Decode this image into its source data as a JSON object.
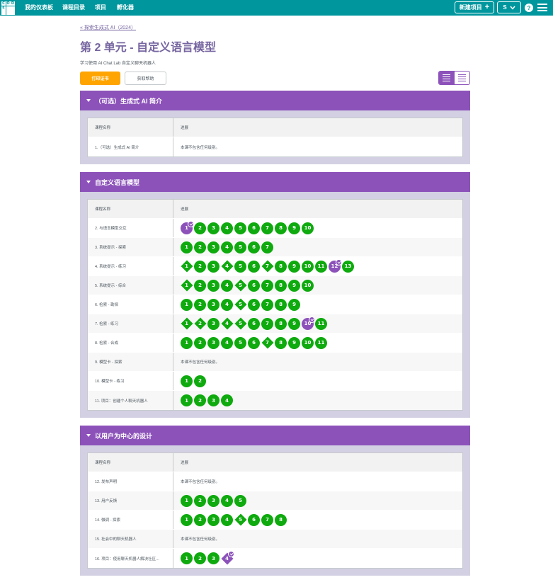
{
  "header": {
    "logo_letters": [
      "C",
      "O",
      "D",
      "E",
      "",
      "",
      "",
      "",
      ""
    ],
    "nav": [
      {
        "label": "我的仪表板"
      },
      {
        "label": "课程目录"
      },
      {
        "label": "项目"
      },
      {
        "label": "孵化器"
      }
    ],
    "new_project_label": "新建项目",
    "new_project_icon": "+",
    "user_initial": "S",
    "help_label": "?"
  },
  "breadcrumb": "« 探索生成式 AI（2024）",
  "title": "第 2 单元 - 自定义语言模型",
  "description": "学习使用 AI Chat Lab 自定义聊天机器人",
  "buttons": {
    "print": "打印证书",
    "help": "获取帮助"
  },
  "colors": {
    "teal": "#00969d",
    "purple": "#8c52ba",
    "green": "#0eaa0e",
    "orange": "#ffa400",
    "title": "#7665a0"
  },
  "table_headers": {
    "name": "课程名称",
    "progress": "进展"
  },
  "no_levels_text": "本课不包含任何级别。",
  "sections": [
    {
      "title": "（可选）生成式 AI 简介",
      "lessons": [
        {
          "name": "1.（可选）生成式 AI 简介",
          "levels": []
        }
      ]
    },
    {
      "title": "自定义语言模型",
      "lessons": [
        {
          "name": "2. 与语言模型交互",
          "levels": [
            {
              "n": "1",
              "shape": "circle",
              "color": "purple",
              "check": true
            },
            {
              "n": "2"
            },
            {
              "n": "3"
            },
            {
              "n": "4"
            },
            {
              "n": "5"
            },
            {
              "n": "6"
            },
            {
              "n": "7"
            },
            {
              "n": "8"
            },
            {
              "n": "9"
            },
            {
              "n": "10"
            }
          ]
        },
        {
          "name": "3. 系统提示 - 探索",
          "levels": [
            {
              "n": "1"
            },
            {
              "n": "2"
            },
            {
              "n": "3"
            },
            {
              "n": "4"
            },
            {
              "n": "5"
            },
            {
              "n": "6"
            },
            {
              "n": "7"
            }
          ]
        },
        {
          "name": "4. 系统提示 - 练习",
          "levels": [
            {
              "n": "1",
              "shape": "diamond"
            },
            {
              "n": "2"
            },
            {
              "n": "3"
            },
            {
              "n": "4",
              "shape": "diamond"
            },
            {
              "n": "5"
            },
            {
              "n": "6"
            },
            {
              "n": "7",
              "shape": "diamond"
            },
            {
              "n": "8"
            },
            {
              "n": "9"
            },
            {
              "n": "10"
            },
            {
              "n": "11"
            },
            {
              "n": "12",
              "color": "purple",
              "check": true
            },
            {
              "n": "13"
            }
          ]
        },
        {
          "name": "5. 系统提示 - 综合",
          "levels": [
            {
              "n": "1",
              "shape": "diamond"
            },
            {
              "n": "2"
            },
            {
              "n": "3"
            },
            {
              "n": "4"
            },
            {
              "n": "5",
              "shape": "diamond"
            },
            {
              "n": "6"
            },
            {
              "n": "7"
            },
            {
              "n": "8"
            },
            {
              "n": "9"
            },
            {
              "n": "10"
            }
          ]
        },
        {
          "name": "6. 检索 - 勘探",
          "levels": [
            {
              "n": "1"
            },
            {
              "n": "2"
            },
            {
              "n": "3"
            },
            {
              "n": "4"
            },
            {
              "n": "5",
              "shape": "diamond"
            },
            {
              "n": "6"
            },
            {
              "n": "7"
            },
            {
              "n": "8"
            },
            {
              "n": "9"
            }
          ]
        },
        {
          "name": "7. 检索 - 练习",
          "levels": [
            {
              "n": "1",
              "shape": "diamond"
            },
            {
              "n": "2",
              "shape": "diamond"
            },
            {
              "n": "3"
            },
            {
              "n": "4",
              "shape": "diamond"
            },
            {
              "n": "5",
              "shape": "diamond"
            },
            {
              "n": "6"
            },
            {
              "n": "7"
            },
            {
              "n": "8"
            },
            {
              "n": "9"
            },
            {
              "n": "10",
              "color": "purple",
              "check": true
            },
            {
              "n": "11"
            }
          ]
        },
        {
          "name": "8. 检索 - 合成",
          "levels": [
            {
              "n": "1"
            },
            {
              "n": "2"
            },
            {
              "n": "3"
            },
            {
              "n": "4"
            },
            {
              "n": "5"
            },
            {
              "n": "6"
            },
            {
              "n": "7",
              "shape": "diamond"
            },
            {
              "n": "8"
            },
            {
              "n": "9"
            },
            {
              "n": "10"
            },
            {
              "n": "11"
            }
          ]
        },
        {
          "name": "9. 模型卡 - 探索",
          "levels": []
        },
        {
          "name": "10. 模型卡 - 练习",
          "levels": [
            {
              "n": "1"
            },
            {
              "n": "2"
            }
          ]
        },
        {
          "name": "11. 项目：创建个人聊天机器人",
          "levels": [
            {
              "n": "1"
            },
            {
              "n": "2"
            },
            {
              "n": "3"
            },
            {
              "n": "4"
            }
          ]
        }
      ]
    },
    {
      "title": "以用户为中心的设计",
      "lessons": [
        {
          "name": "12. 发布声明",
          "levels": []
        },
        {
          "name": "13. 用户反馈",
          "levels": [
            {
              "n": "1"
            },
            {
              "n": "2"
            },
            {
              "n": "3"
            },
            {
              "n": "4"
            },
            {
              "n": "5"
            }
          ]
        },
        {
          "name": "14. 微调 - 探索",
          "levels": [
            {
              "n": "1"
            },
            {
              "n": "2"
            },
            {
              "n": "3"
            },
            {
              "n": "4"
            },
            {
              "n": "5",
              "shape": "diamond"
            },
            {
              "n": "6"
            },
            {
              "n": "7"
            },
            {
              "n": "8"
            }
          ]
        },
        {
          "name": "15. 社会中的聊天机器人",
          "levels": []
        },
        {
          "name": "16. 项目：使用聊天机器人解决社区...",
          "levels": [
            {
              "n": "1"
            },
            {
              "n": "2"
            },
            {
              "n": "3"
            },
            {
              "n": "4",
              "shape": "diamond",
              "color": "purple",
              "check": true
            }
          ]
        }
      ]
    }
  ]
}
